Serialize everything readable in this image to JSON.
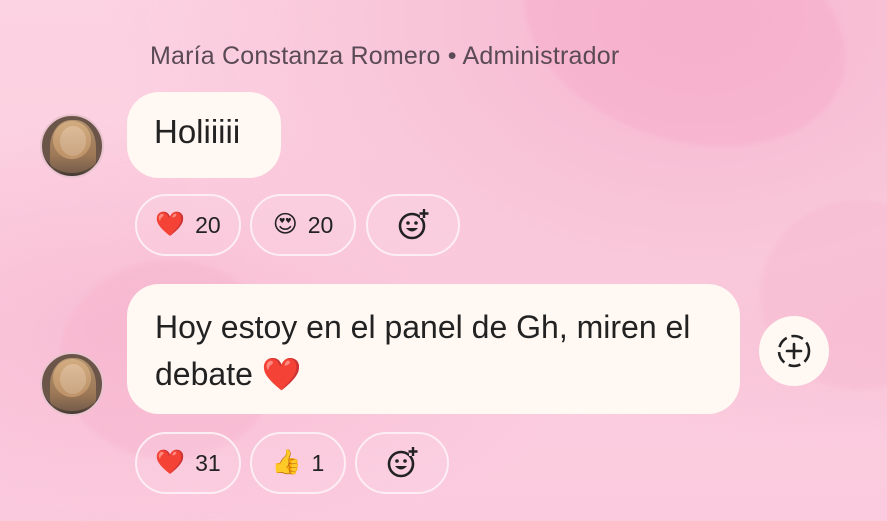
{
  "sender": {
    "name": "María Constanza Romero",
    "separator": "•",
    "role": "Administrador"
  },
  "messages": [
    {
      "text": "Holiiiii",
      "reactions": [
        {
          "emoji": "❤️",
          "icon": "heart-icon",
          "count": "20"
        },
        {
          "emoji": "😍",
          "icon": "heart-eyes-icon",
          "count": "20"
        }
      ],
      "add_reaction_icon": "add-reaction-icon"
    },
    {
      "text": "Hoy estoy en el panel de Gh, miren el debate",
      "trailing_emoji": "❤️",
      "reactions": [
        {
          "emoji": "❤️",
          "icon": "heart-icon",
          "count": "31"
        },
        {
          "emoji": "👍",
          "icon": "thumbs-up-icon",
          "count": "1"
        }
      ],
      "add_reaction_icon": "add-reaction-icon"
    }
  ],
  "colors": {
    "background": "#fcd3e2",
    "bubble": "#fff8f3",
    "heart": "#e0162b"
  }
}
